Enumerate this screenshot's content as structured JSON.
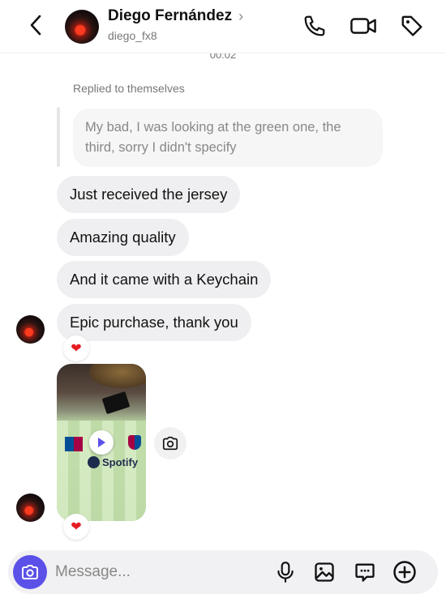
{
  "header": {
    "name": "Diego Fernández",
    "username": "diego_fx8"
  },
  "thread": {
    "timestamp": "00:02",
    "replied_label": "Replied to themselves",
    "quoted_text": "My bad, I was looking at the green one, the third, sorry I didn't specify",
    "messages": [
      "Just received the jersey",
      "Amazing quality",
      "And it came with a Keychain",
      "Epic purchase, thank you"
    ],
    "reaction": "❤",
    "video_brand": "Spotify"
  },
  "composer": {
    "placeholder": "Message..."
  },
  "icons": [
    "back-icon",
    "chevron-right-icon",
    "phone-icon",
    "video-call-icon",
    "tag-icon",
    "play-icon",
    "camera-icon",
    "microphone-icon",
    "gallery-icon",
    "sticker-icon",
    "add-icon"
  ]
}
